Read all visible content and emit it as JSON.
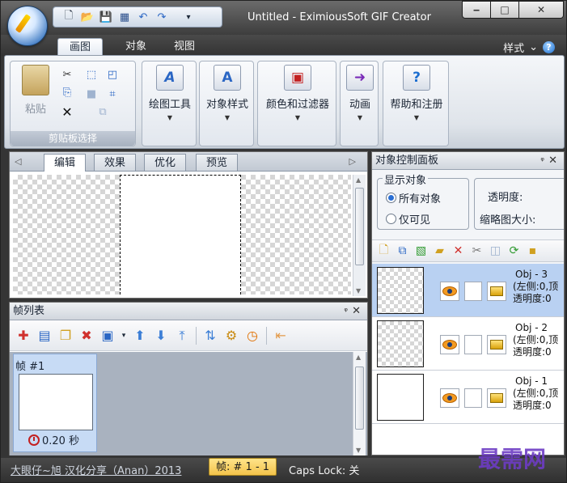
{
  "window": {
    "title": "Untitled - EximiousSoft GIF Creator",
    "min_glyph": "‒",
    "max_glyph": "□",
    "close_glyph": "✕"
  },
  "qat": {
    "icons": [
      "new-icon",
      "open-icon",
      "save-icon",
      "export-icon",
      "undo-icon",
      "redo-icon",
      "customize-icon"
    ],
    "dropdown_glyph": "▾"
  },
  "ribbon_tabs": [
    "画图",
    "对象",
    "视图"
  ],
  "style_menu": {
    "label": "样式",
    "chevron": "⌄",
    "help_glyph": "?"
  },
  "ribbon": {
    "clipboard_group": {
      "paste_label": "粘贴",
      "group_label": "剪贴板选择",
      "delete_glyph": "✕"
    },
    "buttons": [
      {
        "label": "绘图工具",
        "glyph": "A"
      },
      {
        "label": "对象样式",
        "glyph": "A"
      },
      {
        "label": "颜色和过滤器",
        "glyph": "▣"
      },
      {
        "label": "动画",
        "glyph": "➜"
      },
      {
        "label": "帮助和注册",
        "glyph": "?"
      }
    ],
    "dropdown_arrow": "▼"
  },
  "editor": {
    "tabs": [
      "编辑",
      "效果",
      "优化",
      "预览"
    ],
    "active_tab": "编辑",
    "nav_left": "◁",
    "nav_right": "▷"
  },
  "frames_panel": {
    "title": "帧列表",
    "pin": "ᵠ",
    "close": "✕",
    "frame": {
      "name": "帧 #1",
      "delay": "0.20 秒"
    }
  },
  "objects_panel": {
    "title": "对象控制面板",
    "show_group_label": "显示对象",
    "radio_all": "所有对象",
    "radio_visible": "仅可见",
    "opacity_label": "透明度:",
    "thumb_size_label": "缩略图大小:",
    "objects": [
      {
        "name": "Obj - 3",
        "left": "(左侧:0,顶",
        "opacity": "透明度:0",
        "selected": true
      },
      {
        "name": "Obj - 2",
        "left": "(左侧:0,顶",
        "opacity": "透明度:0",
        "selected": false
      },
      {
        "name": "Obj - 1",
        "left": "(左侧:0,顶",
        "opacity": "透明度:0",
        "selected": false
      }
    ]
  },
  "statusbar": {
    "credit": "大眼仔~旭 汉化分享（Anan）2013",
    "frame": "帧: # 1 - 1",
    "caps": "Caps Lock: 关"
  },
  "watermark": "最需网",
  "colors": {
    "chrome_dark": "#353535",
    "ribbon_light": "#f4f6f9",
    "selection_blue": "#b9d1f2",
    "status_highlight": "#ffe48a",
    "watermark_purple": "#6d3cc4"
  }
}
